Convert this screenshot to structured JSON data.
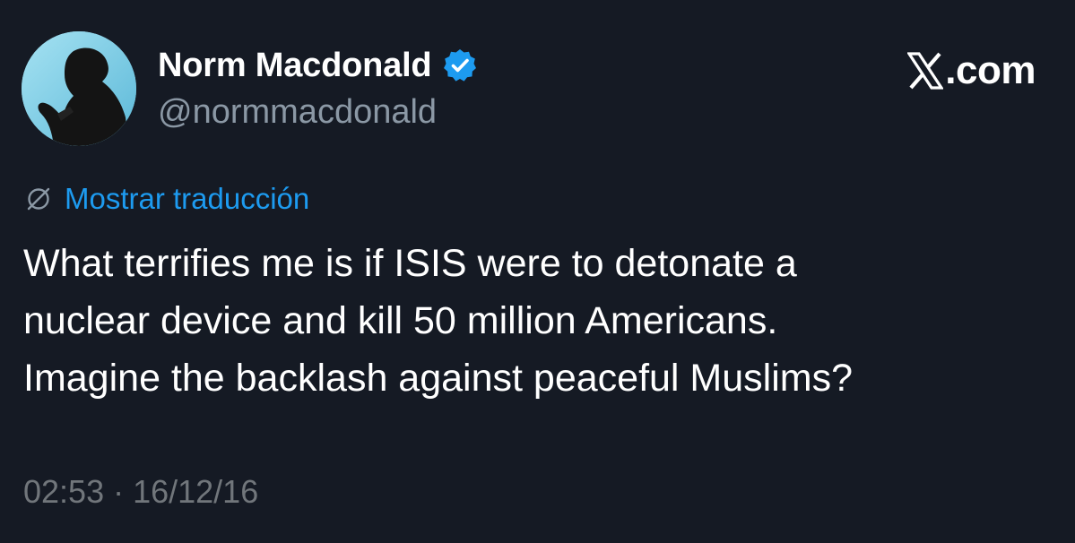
{
  "author": {
    "display_name": "Norm Macdonald",
    "handle": "@normmacdonald",
    "verified": true
  },
  "brand": {
    "text": ".com",
    "icon": "x-logo-icon"
  },
  "translate": {
    "label": "Mostrar traducción",
    "icon": "globe-slash-icon"
  },
  "tweet": {
    "lines": [
      "What terrifies me is if ISIS were to detonate a",
      "nuclear device and kill 50 million Americans.",
      "Imagine the backlash against peaceful Muslims?"
    ]
  },
  "timestamp": "02:53 · 16/12/16",
  "colors": {
    "background": "#151a24",
    "link": "#1d9bf0",
    "secondary_text": "#8b98a5",
    "verified": "#1d9bf0"
  }
}
